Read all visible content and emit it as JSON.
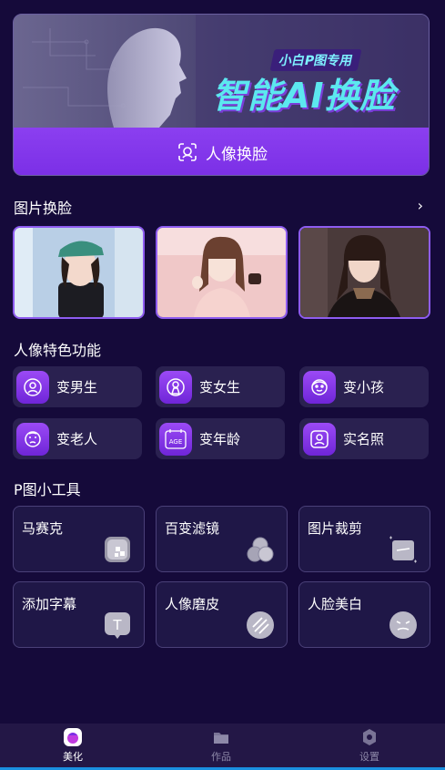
{
  "banner": {
    "tag": "小白P图专用",
    "title": "智能AI换脸",
    "button_label": "人像换脸"
  },
  "face_swap": {
    "title": "图片换脸",
    "more": "›"
  },
  "portrait": {
    "title": "人像特色功能",
    "items": [
      {
        "label": "变男生",
        "icon": "male-face-icon"
      },
      {
        "label": "变女生",
        "icon": "female-face-icon"
      },
      {
        "label": "变小孩",
        "icon": "child-face-icon"
      },
      {
        "label": "变老人",
        "icon": "elder-face-icon"
      },
      {
        "label": "变年龄",
        "icon": "age-icon",
        "icon_text": "AGE"
      },
      {
        "label": "实名照",
        "icon": "id-photo-icon"
      }
    ]
  },
  "tools": {
    "title": "P图小工具",
    "items": [
      {
        "label": "马赛克",
        "icon": "mosaic-icon"
      },
      {
        "label": "百变滤镜",
        "icon": "filter-icon"
      },
      {
        "label": "图片裁剪",
        "icon": "crop-icon"
      },
      {
        "label": "添加字幕",
        "icon": "text-icon",
        "icon_text": "T"
      },
      {
        "label": "人像磨皮",
        "icon": "smooth-skin-icon"
      },
      {
        "label": "人脸美白",
        "icon": "whitening-icon"
      }
    ]
  },
  "nav": {
    "items": [
      {
        "label": "美化",
        "active": true
      },
      {
        "label": "作品",
        "active": false
      },
      {
        "label": "设置",
        "active": false
      }
    ]
  },
  "colors": {
    "background": "#150a3a",
    "accent": "#7b2fe6",
    "card": "#2a2150"
  }
}
